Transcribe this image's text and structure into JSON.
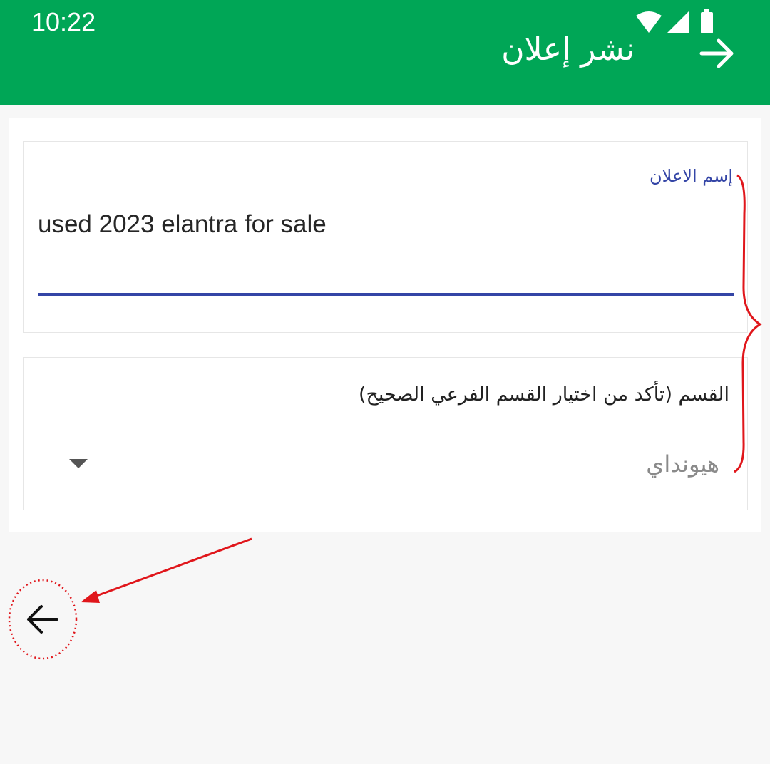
{
  "status_bar": {
    "time": "10:22",
    "icons": [
      "wifi-icon",
      "signal-icon",
      "battery-icon"
    ]
  },
  "appbar": {
    "title": "نشر إعلان",
    "forward_icon": "arrow-right-icon",
    "color": "#00a656"
  },
  "form": {
    "ad_name": {
      "label": "إسم الاعلان",
      "value": "used 2023 elantra for sale"
    },
    "category": {
      "label": "القسم (تأكد من اختيار القسم الفرعي الصحيح)",
      "selected": "هيونداي",
      "dropdown_icon": "dropdown-arrow-icon"
    }
  },
  "floating": {
    "back_icon": "arrow-left-icon"
  },
  "colors": {
    "accent": "#3445a6",
    "annotation": "#e0161b"
  }
}
